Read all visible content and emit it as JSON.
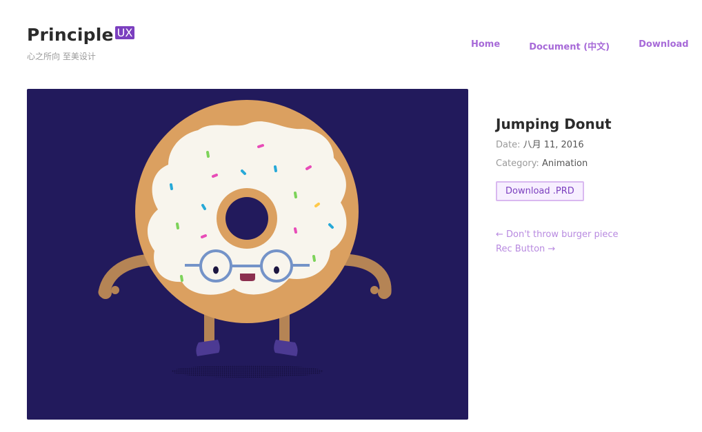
{
  "header": {
    "logo_text": "Principle",
    "logo_badge": "UX",
    "tagline": "心之所向 至美设计",
    "nav": [
      "Home",
      "Document (中文)",
      "Download"
    ]
  },
  "artwork": {
    "background": "#221a5c",
    "subject": "donut-character"
  },
  "post": {
    "title": "Jumping Donut",
    "date_label": "Date:",
    "date_value": "八月 11, 2016",
    "category_label": "Category:",
    "category_value": "Animation",
    "download_button": "Download .PRD",
    "prev_link": "← Don't throw burger piece",
    "next_link": "Rec Button →"
  },
  "colors": {
    "accent": "#7b3fbf",
    "nav_link": "#a76ad8",
    "donut_dough": "#dba060",
    "frosting": "#f8f5ed"
  }
}
